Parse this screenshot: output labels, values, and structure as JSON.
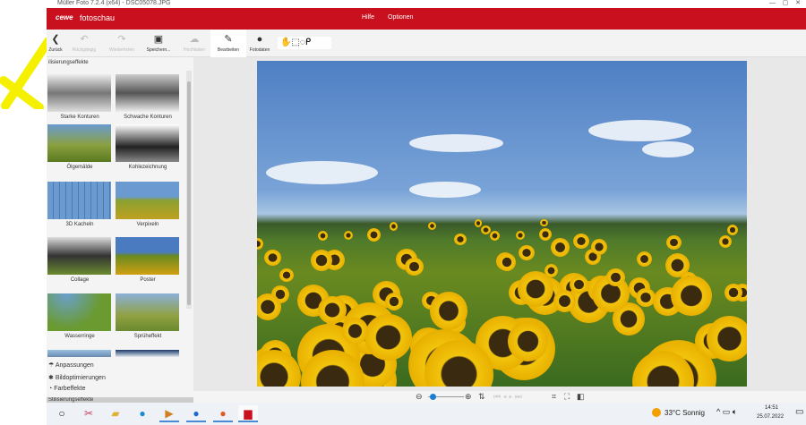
{
  "window": {
    "title": "Müller Foto 7.2.4 (x64) - DSC05078.JPG"
  },
  "appbar": {
    "logo": "cewe",
    "product": "fotoschau",
    "menu": [
      "Hilfe",
      "Optionen"
    ]
  },
  "toolbar": {
    "buttons": [
      {
        "label": "Zurück",
        "icon": "back-icon",
        "enabled": true
      },
      {
        "label": "Rückgängig",
        "icon": "undo-icon",
        "enabled": false
      },
      {
        "label": "Wiederholen",
        "icon": "redo-icon",
        "enabled": false
      },
      {
        "label": "Speichern...",
        "icon": "save-icon",
        "enabled": true
      },
      {
        "label": "Hochladen",
        "icon": "upload-icon",
        "enabled": false
      },
      {
        "label": "Bearbeiten",
        "icon": "edit-icon",
        "enabled": true
      },
      {
        "label": "Fotodaten",
        "icon": "info-icon",
        "enabled": true
      }
    ],
    "tools": [
      "hand-icon",
      "rect-select-icon",
      "ellipse-select-icon",
      "lasso-icon"
    ]
  },
  "sidebar": {
    "heading": "ilisierungseffekte",
    "effects": [
      "Starke Konturen",
      "Schwache Konturen",
      "Ölgemälde",
      "Kohlezeichnung",
      "3D Kacheln",
      "Verpixeln",
      "Collage",
      "Poster",
      "Wasserringe",
      "Sprüheffekt"
    ],
    "sections": [
      "Anpassungen",
      "Bildoptimierungen",
      "Farbeffekte",
      "Stilisierungseffekte"
    ]
  },
  "taskbar": {
    "weather": "33°C  Sonnig",
    "time": "14:51",
    "date": "25.07.2022"
  },
  "colors": {
    "brand": "#c8101e"
  }
}
